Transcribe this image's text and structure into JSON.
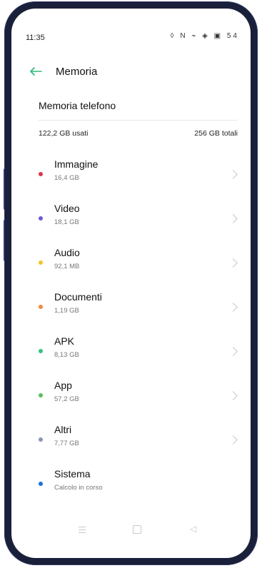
{
  "status_bar": {
    "time": "11:35",
    "icons_text": "◊ N ⌁ ◈ ▣ 54"
  },
  "header": {
    "title": "Memoria"
  },
  "storage": {
    "section_title": "Memoria telefono",
    "used": "122,2 GB usati",
    "total": "256 GB totali"
  },
  "items": [
    {
      "label": "Immagine",
      "size": "16,4 GB",
      "color": "#e0334b",
      "has_chevron": true
    },
    {
      "label": "Video",
      "size": "18,1 GB",
      "color": "#6a5ad6",
      "has_chevron": true
    },
    {
      "label": "Audio",
      "size": "92,1 MB",
      "color": "#f4c321",
      "has_chevron": true
    },
    {
      "label": "Documenti",
      "size": "1,19 GB",
      "color": "#f08a3c",
      "has_chevron": true
    },
    {
      "label": "APK",
      "size": "8,13 GB",
      "color": "#34c27a",
      "has_chevron": true
    },
    {
      "label": "App",
      "size": "57,2 GB",
      "color": "#59be5c",
      "has_chevron": true
    },
    {
      "label": "Altri",
      "size": "7,77 GB",
      "color": "#8a93b2",
      "has_chevron": true
    },
    {
      "label": "Sistema",
      "size": "Calcolo in corso",
      "color": "#1a6fe0",
      "has_chevron": false
    }
  ],
  "colors": {
    "accent": "#2fb872",
    "bezel": "#1a1f3a"
  }
}
